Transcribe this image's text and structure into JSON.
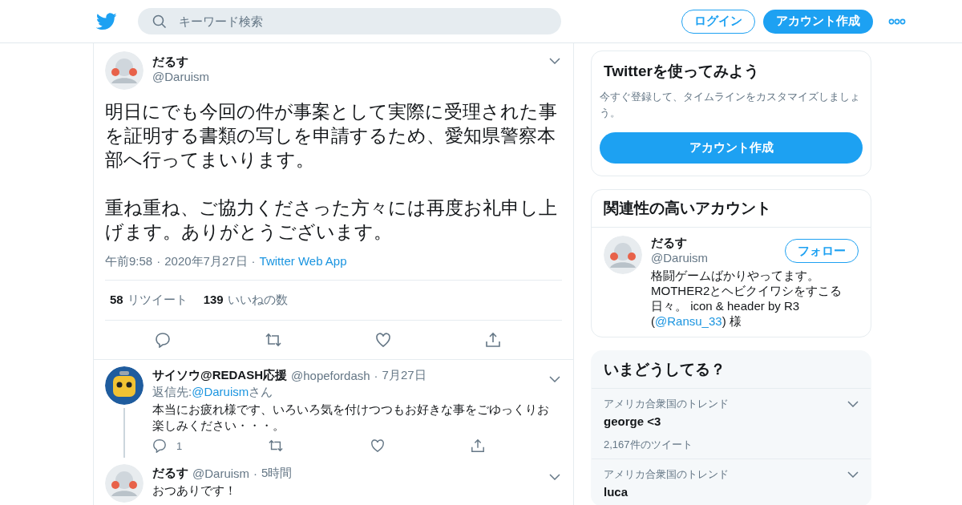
{
  "header": {
    "search": {
      "placeholder": "キーワード検索"
    },
    "login": "ログイン",
    "signup": "アカウント作成"
  },
  "tweet": {
    "name": "だるす",
    "handle": "@Daruism",
    "paragraphs": [
      "明日にでも今回の件が事案として実際に受理された事を証明する書類の写しを申請するため、愛知県警察本部へ行ってまいります。",
      "重ね重ね、ご協力くださった方々には再度お礼申し上げます。ありがとうございます。"
    ],
    "time": "午前9:58",
    "separator": "·",
    "date": "2020年7月27日",
    "source": "Twitter Web App",
    "stats": [
      {
        "count": "58",
        "label": "リツイート"
      },
      {
        "count": "139",
        "label": "いいねの数"
      }
    ]
  },
  "replies": [
    {
      "name": "サイソウ@REDASH応援",
      "handle": "@hopefordash",
      "separator": "·",
      "date": "7月27日",
      "reply_label": "返信先:",
      "reply_to": "@Daruism",
      "reply_suffix": "さん",
      "text": "本当にお疲れ様です、いろいろ気を付けつつもお好きな事をごゆっくりお楽しみください・・・。",
      "reply_count": "1",
      "kind": "robot",
      "thread": true
    },
    {
      "name": "だるす",
      "handle": "@Daruism",
      "separator": "·",
      "date": "5時間",
      "text": "おつありです！",
      "kind": "user",
      "thread": false
    }
  ],
  "sidebar": {
    "signup_card": {
      "title": "Twitterを使ってみよう",
      "description": "今すぐ登録して、タイムラインをカスタマイズしましょう。",
      "button": "アカウント作成"
    },
    "related": {
      "title": "関連性の高いアカウント",
      "accounts": [
        {
          "name": "だるす",
          "handle": "@Daruism",
          "follow": "フォロー",
          "bio": [
            "格闘ゲームばかりやってます。MOTHER2とヘビクイワシをすこる日々。 icon & header by R3 (",
            "@Ransu_33",
            ") 様"
          ]
        }
      ]
    },
    "trends": {
      "title": "いまどうしてる？",
      "items": [
        {
          "context": "アメリカ合衆国のトレンド",
          "topic": "george <3",
          "count": "2,167件のツイート"
        },
        {
          "context": "アメリカ合衆国のトレンド",
          "topic": "luca"
        }
      ]
    }
  }
}
